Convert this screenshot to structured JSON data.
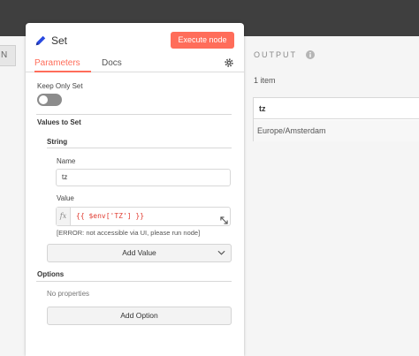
{
  "stub": {
    "label": "N"
  },
  "panel": {
    "title": "Set",
    "execute_label": "Execute node",
    "tabs": [
      {
        "label": "Parameters",
        "active": true
      },
      {
        "label": "Docs",
        "active": false
      }
    ],
    "keep_only_set": {
      "label": "Keep Only Set",
      "on": false
    },
    "values_to_set": {
      "label": "Values to Set",
      "group_label": "String",
      "name_label": "Name",
      "name_value": "tz",
      "value_label": "Value",
      "fx": "fx",
      "value_expression": "{{ $env['TZ'] }}",
      "error": "[ERROR: not accessible via UI, please run node]",
      "add_value_label": "Add Value"
    },
    "options": {
      "label": "Options",
      "empty_text": "No properties",
      "add_option_label": "Add Option"
    }
  },
  "output": {
    "title": "OUTPUT",
    "count": "1 item",
    "columns": [
      "tz"
    ],
    "rows": [
      [
        "Europe/Amsterdam"
      ]
    ]
  },
  "colors": {
    "accent": "#ff6d5a",
    "expression": "#e03c31"
  }
}
